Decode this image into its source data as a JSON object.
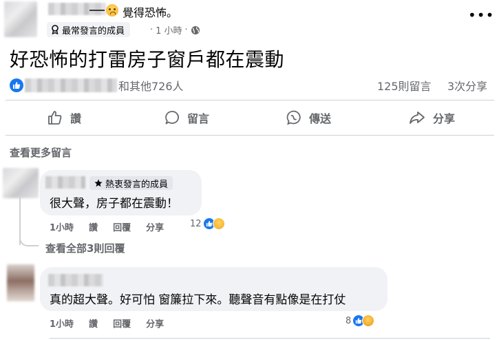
{
  "post": {
    "feeling": "覺得恐怖。",
    "badge": "最常發言的成員",
    "time": "1 小時",
    "privacy_icon": "globe-icon",
    "title": "好恐怖的打雷房子窗戶都在震動",
    "reactors_text": "和其他726人",
    "comments_count": "125則留言",
    "shares_count": "3次分享"
  },
  "actions": {
    "like": "讚",
    "comment": "留言",
    "send": "傳送",
    "share": "分享"
  },
  "more_comments": "查看更多留言",
  "comments": [
    {
      "badge": "熱衷發言的成員",
      "text": "很大聲，房子都在震動！",
      "time": "1小時",
      "like": "讚",
      "reply": "回覆",
      "share": "分享",
      "reaction_count": "12",
      "view_replies": "查看全部3則回覆"
    },
    {
      "text": "真的超大聲。好可怕 窗簾拉下來。聽聲音有點像是在打仗",
      "time": "1小時",
      "like": "讚",
      "reply": "回覆",
      "share": "分享",
      "reaction_count": "8"
    }
  ],
  "colors": {
    "accent": "#1877f2",
    "secondary_text": "#65676b",
    "bubble": "#f0f2f5"
  }
}
